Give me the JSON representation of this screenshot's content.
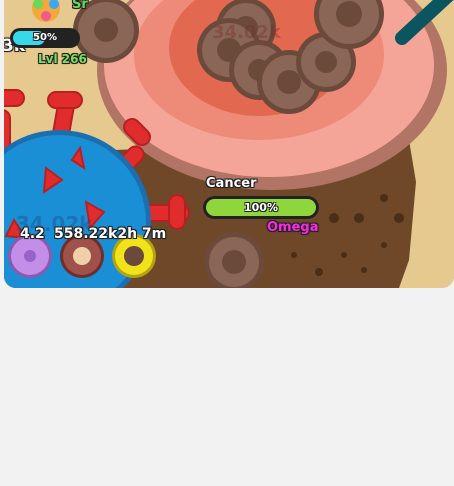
{
  "boss": {
    "name": "Cancer",
    "health_text": "100%",
    "health_fraction": 1.0,
    "rarity": "Omega",
    "rarity_color": "#ff27e6",
    "ghost_score": "34.02k"
  },
  "player": {
    "name_partial": "Sr",
    "level_label": "Lvl 266",
    "health_text": "50%",
    "health_fraction": 0.5,
    "score_partial": "3k",
    "ghost_score": "34.02k"
  },
  "petal_bar": {
    "timer_text": "4.2",
    "stats_text": "558.22k2h 7m"
  },
  "colors": {
    "sand": "#e6c98e",
    "dirt": "#6e4828",
    "boss_outer": "#f5a598",
    "boss_inner": "#e2684f",
    "player_body": "#1b8fd6",
    "virus_red": "#e02c2c",
    "rock": "#8a6656",
    "hp_green": "#8ed63c",
    "hp_cyan": "#36d8ea"
  },
  "petals": [
    {
      "name": "purple-petal-icon",
      "color": "#c28ee8"
    },
    {
      "name": "brown-petal-icon",
      "color": "#a0524a"
    },
    {
      "name": "yellow-petal-icon",
      "color": "#f2e21a"
    }
  ]
}
